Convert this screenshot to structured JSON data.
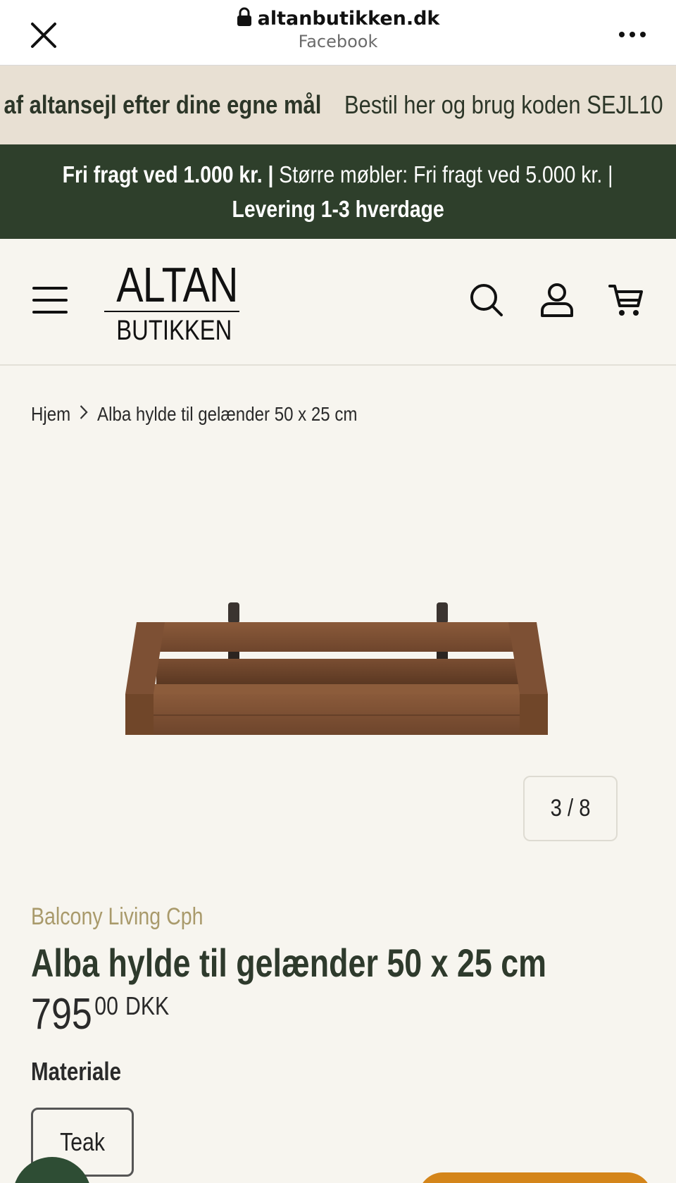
{
  "browser": {
    "domain": "altanbutikken.dk",
    "source": "Facebook"
  },
  "promo": {
    "bold_text": "b af altansejl efter dine egne mål",
    "light_text": "Bestil her og brug koden SEJL10"
  },
  "shipping": {
    "part1": "Fri fragt ved 1.000 kr. |",
    "part2": " Større møbler: Fri fragt ved 5.000 kr. |",
    "part3": "Levering 1-3 hverdage"
  },
  "logo": {
    "top": "ALTAN",
    "bottom": "BUTIKKEN"
  },
  "breadcrumb": {
    "home": "Hjem",
    "current": "Alba hylde til gelænder 50 x 25 cm"
  },
  "gallery": {
    "counter": "3 / 8"
  },
  "product": {
    "vendor": "Balcony Living Cph",
    "title": "Alba hylde til gelænder 50 x 25 cm",
    "price_main": "795",
    "price_cents": "00",
    "currency": "DKK",
    "option_label": "Materiale",
    "option_value": "Teak"
  },
  "colors": {
    "promo_bg": "#e8e0d3",
    "shipping_bg": "#2e3f2b",
    "vendor": "#a99a6b",
    "title": "#2e3a2c",
    "cart_button": "#d4851a"
  }
}
